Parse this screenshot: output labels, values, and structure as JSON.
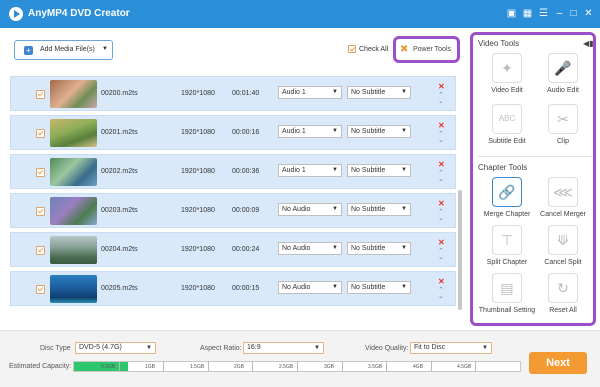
{
  "app": {
    "title": "AnyMP4 DVD Creator"
  },
  "toolbar": {
    "add_media": "Add Media File(s)",
    "check_all": "Check All",
    "power_tools": "Power Tools"
  },
  "files": [
    {
      "name": "00200.m2ts",
      "resolution": "1920*1080",
      "duration": "00:01:40",
      "audio": "Audio 1",
      "subtitle": "No Subtitle"
    },
    {
      "name": "00201.m2ts",
      "resolution": "1920*1080",
      "duration": "00:00:16",
      "audio": "Audio 1",
      "subtitle": "No Subtitle"
    },
    {
      "name": "00202.m2ts",
      "resolution": "1920*1080",
      "duration": "00:00:36",
      "audio": "Audio 1",
      "subtitle": "No Subtitle"
    },
    {
      "name": "00203.m2ts",
      "resolution": "1920*1080",
      "duration": "00:00:09",
      "audio": "No Audio",
      "subtitle": "No Subtitle"
    },
    {
      "name": "00204.m2ts",
      "resolution": "1920*1080",
      "duration": "00:00:24",
      "audio": "No Audio",
      "subtitle": "No Subtitle"
    },
    {
      "name": "00205.m2ts",
      "resolution": "1920*1080",
      "duration": "00:00:15",
      "audio": "No Audio",
      "subtitle": "No Subtitle"
    }
  ],
  "video_tools": {
    "title": "Video Tools",
    "items": [
      {
        "label": "Video Edit",
        "icon": "wand-icon"
      },
      {
        "label": "Audio Edit",
        "icon": "microphone-icon"
      },
      {
        "label": "Subtitle Edit",
        "icon": "abc-icon"
      },
      {
        "label": "Clip",
        "icon": "scissors-icon"
      }
    ]
  },
  "chapter_tools": {
    "title": "Chapter Tools",
    "items": [
      {
        "label": "Merge Chapter",
        "icon": "link-icon"
      },
      {
        "label": "Cancel Merger",
        "icon": "broken-link-icon"
      },
      {
        "label": "Split Chapter",
        "icon": "split-icon"
      },
      {
        "label": "Cancel Split",
        "icon": "cancel-split-icon"
      },
      {
        "label": "Thumbnail Setting",
        "icon": "thumbnail-icon"
      },
      {
        "label": "Reset All",
        "icon": "reset-icon"
      }
    ]
  },
  "footer": {
    "disc_type_label": "Disc Type",
    "disc_type": "DVD-5 (4.7G)",
    "aspect_label": "Aspect Ratio:",
    "aspect": "16:9",
    "quality_label": "Video Quality:",
    "quality": "Fit to Disc",
    "capacity_label": "Estimated Capacity:",
    "capacity_fraction": 0.12,
    "ticks": [
      "0.5GB",
      "1GB",
      "1.5GB",
      "2GB",
      "2.5GB",
      "3GB",
      "3.5GB",
      "4GB",
      "4.5GB"
    ],
    "next": "Next"
  },
  "colors": {
    "titlebar": "#2a8fd8",
    "highlight": "#9c4fc9",
    "row_bg": "#d9e9fa",
    "next": "#f39a32",
    "capacity": "#2fc76d"
  }
}
